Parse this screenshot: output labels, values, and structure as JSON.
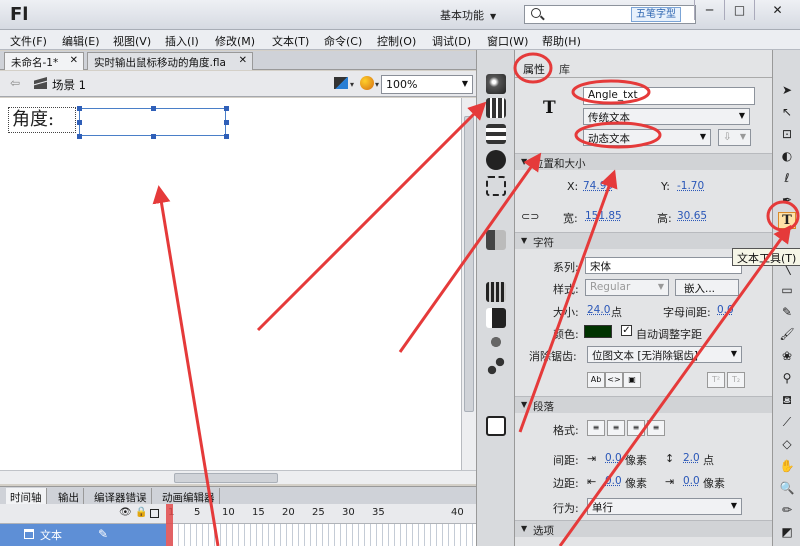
{
  "window": {
    "app_logo": "Fl",
    "workspace": "基本功能",
    "watermark": "五笔字型",
    "minimize": "─",
    "maximize": "□",
    "close": "✕"
  },
  "menu": [
    {
      "label": "文件(F)"
    },
    {
      "label": "编辑(E)"
    },
    {
      "label": "视图(V)"
    },
    {
      "label": "插入(I)"
    },
    {
      "label": "修改(M)"
    },
    {
      "label": "文本(T)"
    },
    {
      "label": "命令(C)"
    },
    {
      "label": "控制(O)"
    },
    {
      "label": "调试(D)"
    },
    {
      "label": "窗口(W)"
    },
    {
      "label": "帮助(H)"
    }
  ],
  "documents": {
    "tabs": [
      {
        "label": "未命名-1*"
      },
      {
        "label": "实时输出鼠标移动的角度.fla"
      }
    ],
    "scene": "场景 1",
    "zoom": "100%"
  },
  "stage": {
    "label_text": "角度:"
  },
  "timeline": {
    "tabs": [
      {
        "label": "时间轴"
      },
      {
        "label": "输出"
      },
      {
        "label": "编译器错误"
      },
      {
        "label": "动画编辑器"
      }
    ],
    "frame_numbers": [
      "1",
      "5",
      "10",
      "15",
      "20",
      "25",
      "30",
      "35",
      "40"
    ],
    "layer_name": "文本"
  },
  "properties": {
    "tabs": [
      {
        "label": "属性"
      },
      {
        "label": "库"
      }
    ],
    "instance_name": "Angle_txt",
    "text_engine": "传统文本",
    "text_type": "动态文本",
    "position_section": "位置和大小",
    "x_label": "X:",
    "x_value": "74.95",
    "y_label": "Y:",
    "y_value": "-1.70",
    "width_label": "宽:",
    "width_value": "151.85",
    "height_label": "高:",
    "height_value": "30.65",
    "char_section": "字符",
    "family_label": "系列:",
    "family_value": "宋体",
    "style_label": "样式:",
    "style_value": "Regular",
    "embed_label": "嵌入...",
    "size_label": "大小:",
    "size_value": "24.0",
    "size_unit": "点",
    "spacing_label": "字母间距:",
    "spacing_value": "0.0",
    "color_label": "颜色:",
    "autokern_label": "自动调整字距",
    "aa_label": "消除锯齿:",
    "aa_value": "位图文本 [无消除锯齿]",
    "para_section": "段落",
    "format_label": "格式:",
    "gap_label": "间距:",
    "gap_indent": "0.0",
    "gap_indent_unit": "像素",
    "gap_line": "2.0",
    "gap_line_unit": "点",
    "margin_label": "边距:",
    "margin_left": "0.0",
    "margin_left_unit": "像素",
    "margin_right": "0.0",
    "margin_right_unit": "像素",
    "behavior_label": "行为:",
    "behavior_value": "单行",
    "options_section": "选项"
  },
  "toolbar": {
    "tooltip": "文本工具(T)",
    "text_tool": "T"
  },
  "colors": {
    "annotation": "#e53a3a",
    "selection": "#2f5fb8",
    "text_color": "#003300"
  }
}
